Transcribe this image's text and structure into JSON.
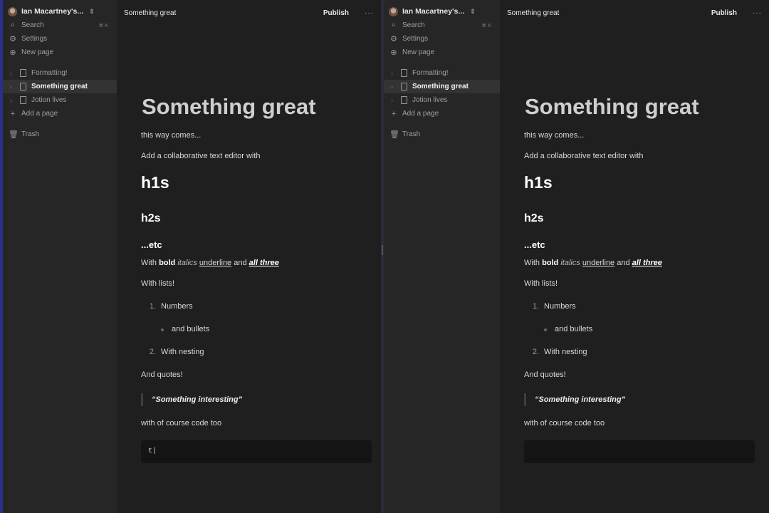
{
  "windows": [
    {
      "workspace": "Ian Macartney's...",
      "nav": {
        "search": "Search",
        "search_shortcut": "⌘ K",
        "settings": "Settings",
        "new_page": "New page"
      },
      "pages": [
        "Formatting!",
        "Something great",
        "Jotion lives"
      ],
      "add_page": "Add a page",
      "trash": "Trash",
      "topbar": {
        "title": "Something great",
        "publish": "Publish",
        "more": "···"
      },
      "doc": {
        "title": "Something great",
        "p1": "this way comes...",
        "p2": "Add a collaborative text editor with",
        "h1": "h1s",
        "h2": "h2s",
        "h3": "...etc",
        "fmt": {
          "with": "With ",
          "bold": "bold",
          "italics": "italics",
          "underline": "underline",
          "and": " and ",
          "all": "all three"
        },
        "lists": "With lists!",
        "li1_num": "1.",
        "li1": "Numbers",
        "bullet": "and bullets",
        "li2_num": "2.",
        "li2": "With nesting",
        "quotes": "And quotes!",
        "quote": "“Something interesting”",
        "code_intro": "with of course code too",
        "code": "t|"
      }
    },
    {
      "workspace": "Ian Macartney's...",
      "nav": {
        "search": "Search",
        "search_shortcut": "⌘ K",
        "settings": "Settings",
        "new_page": "New page"
      },
      "pages": [
        "Formatting!",
        "Something great",
        "Jotion lives"
      ],
      "add_page": "Add a page",
      "trash": "Trash",
      "topbar": {
        "title": "Something great",
        "publish": "Publish",
        "more": "···"
      },
      "doc": {
        "title": "Something great",
        "p1": "this way comes...",
        "p2": "Add a collaborative text editor with",
        "h1": "h1s",
        "h2": "h2s",
        "h3": "...etc",
        "fmt": {
          "with": "With ",
          "bold": "bold",
          "italics": "italics",
          "underline": "underline",
          "and": " and ",
          "all": "all three"
        },
        "lists": "With lists!",
        "li1_num": "1.",
        "li1": "Numbers",
        "bullet": "and bullets",
        "li2_num": "2.",
        "li2": "With nesting",
        "quotes": "And quotes!",
        "quote": "“Something interesting”",
        "code_intro": "with of course code too",
        "code": ""
      }
    }
  ]
}
